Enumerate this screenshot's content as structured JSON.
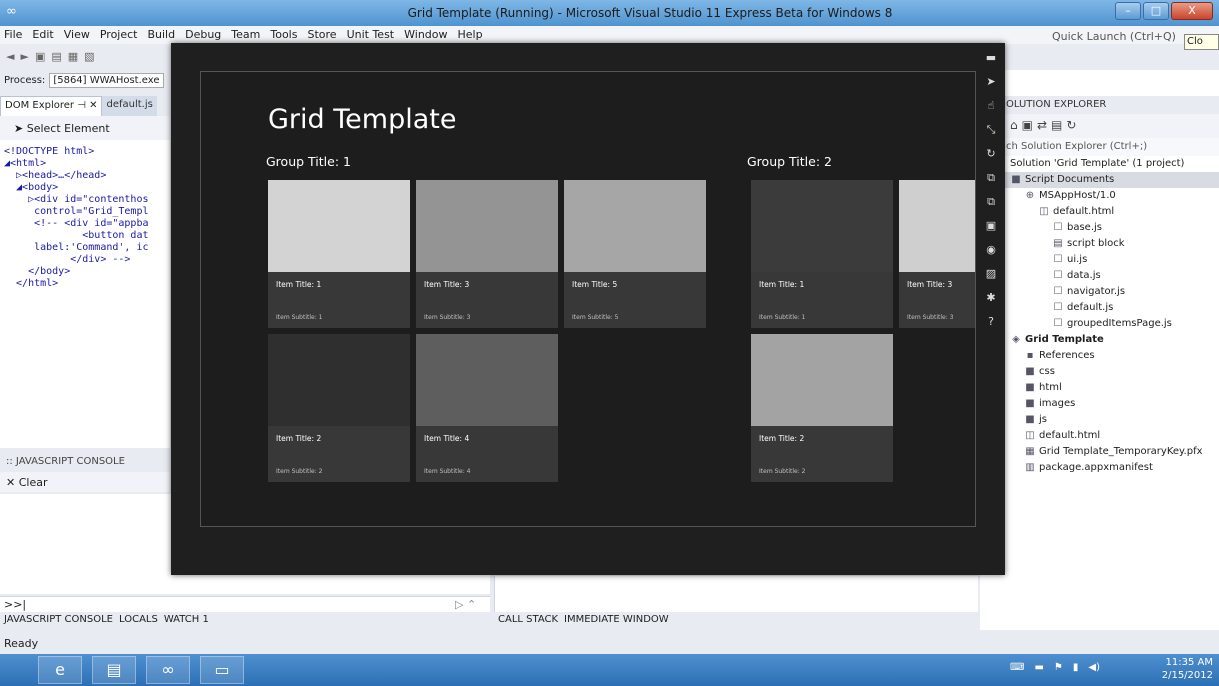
{
  "window": {
    "title": "Grid Template (Running) - Microsoft Visual Studio 11 Express Beta for Windows 8",
    "icon": "vs-icon",
    "buttons": [
      "minimize",
      "maximize",
      "close"
    ],
    "close_label": "X"
  },
  "menu": {
    "items": [
      "File",
      "Edit",
      "View",
      "Project",
      "Build",
      "Debug",
      "Team",
      "Tools",
      "Store",
      "Unit Test",
      "Window",
      "Help"
    ],
    "quick_launch_placeholder": "Quick Launch (Ctrl+Q)",
    "tooltip": "Clo"
  },
  "process": {
    "label": "Process:",
    "value": "[5864] WWAHost.exe"
  },
  "dom_explorer": {
    "tabs": [
      "DOM Explorer ⊣ ✕",
      "default.js"
    ],
    "select_element": "Select Element",
    "tree": [
      "<!DOCTYPE html>",
      "◢<html>",
      "  ▷<head>…</head>",
      "  ◢<body>",
      "    ▷<div id=\"contenthos",
      "     control=\"Grid_Templ",
      "     <!-- <div id=\"appba",
      "             <button dat",
      "     label:'Command', ic",
      "           </div> -->",
      "    </body>",
      "  </html>"
    ]
  },
  "js_console": {
    "header": ":: JAVASCRIPT CONSOLE",
    "clear": "Clear",
    "prompt": ">>|",
    "bottom_tabs_left": [
      "JAVASCRIPT CONSOLE",
      "LOCALS",
      "WATCH 1"
    ],
    "bottom_tabs_right": [
      "CALL STACK",
      "IMMEDIATE WINDOW"
    ]
  },
  "status": {
    "text": "Ready"
  },
  "solution_explorer": {
    "header": "OLUTION EXPLORER",
    "search_placeholder": "ch Solution Explorer (Ctrl+;)",
    "rows": [
      {
        "label": "Solution 'Grid Template' (1 project)",
        "indent": 0,
        "icon": "",
        "sel": false,
        "bold": false
      },
      {
        "label": "Script Documents",
        "indent": 0,
        "icon": "folder",
        "sel": true,
        "bold": false
      },
      {
        "label": "MSAppHost/1.0",
        "indent": 1,
        "icon": "globe",
        "sel": false,
        "bold": false
      },
      {
        "label": "default.html",
        "indent": 2,
        "icon": "html",
        "sel": false,
        "bold": false
      },
      {
        "label": "base.js",
        "indent": 3,
        "icon": "js",
        "sel": false,
        "bold": false
      },
      {
        "label": "script block",
        "indent": 3,
        "icon": "doc",
        "sel": false,
        "bold": false
      },
      {
        "label": "ui.js",
        "indent": 3,
        "icon": "js",
        "sel": false,
        "bold": false
      },
      {
        "label": "data.js",
        "indent": 3,
        "icon": "js",
        "sel": false,
        "bold": false
      },
      {
        "label": "navigator.js",
        "indent": 3,
        "icon": "js",
        "sel": false,
        "bold": false
      },
      {
        "label": "default.js",
        "indent": 3,
        "icon": "js",
        "sel": false,
        "bold": false
      },
      {
        "label": "groupedItemsPage.js",
        "indent": 3,
        "icon": "js",
        "sel": false,
        "bold": false
      },
      {
        "label": "Grid Template",
        "indent": 0,
        "icon": "project",
        "sel": false,
        "bold": true
      },
      {
        "label": "References",
        "indent": 1,
        "icon": "refs",
        "sel": false,
        "bold": false
      },
      {
        "label": "css",
        "indent": 1,
        "icon": "folder",
        "sel": false,
        "bold": false
      },
      {
        "label": "html",
        "indent": 1,
        "icon": "folder",
        "sel": false,
        "bold": false
      },
      {
        "label": "images",
        "indent": 1,
        "icon": "folder",
        "sel": false,
        "bold": false
      },
      {
        "label": "js",
        "indent": 1,
        "icon": "folder",
        "sel": false,
        "bold": false
      },
      {
        "label": "default.html",
        "indent": 1,
        "icon": "html",
        "sel": false,
        "bold": false
      },
      {
        "label": "Grid Template_TemporaryKey.pfx",
        "indent": 1,
        "icon": "cert",
        "sel": false,
        "bold": false
      },
      {
        "label": "package.appxmanifest",
        "indent": 1,
        "icon": "manifest",
        "sel": false,
        "bold": false
      }
    ]
  },
  "app": {
    "title": "Grid Template",
    "groups": [
      {
        "title": "Group Title: 1",
        "items": [
          {
            "title": "Item Title: 1",
            "subtitle": "Item Subtitle: 1",
            "color": "#d3d3d3"
          },
          {
            "title": "Item Title: 3",
            "subtitle": "Item Subtitle: 3",
            "color": "#949494"
          },
          {
            "title": "Item Title: 5",
            "subtitle": "Item Subtitle: 5",
            "color": "#a6a6a6"
          },
          {
            "title": "Item Title: 2",
            "subtitle": "Item Subtitle: 2",
            "color": "#2f2f2f"
          },
          {
            "title": "Item Title: 4",
            "subtitle": "Item Subtitle: 4",
            "color": "#5e5e5e"
          }
        ]
      },
      {
        "title": "Group Title: 2",
        "items": [
          {
            "title": "Item Title: 1",
            "subtitle": "Item Subtitle: 1",
            "color": "#3b3b3b"
          },
          {
            "title": "Item Title: 3",
            "subtitle": "Item Subtitle: 3",
            "color": "#cfcfcf"
          },
          {
            "title": "Item Title: 2",
            "subtitle": "Item Subtitle: 2",
            "color": "#a3a3a3"
          }
        ]
      }
    ]
  },
  "taskbar": {
    "clock_time": "11:35 AM",
    "clock_date": "2/15/2012"
  }
}
